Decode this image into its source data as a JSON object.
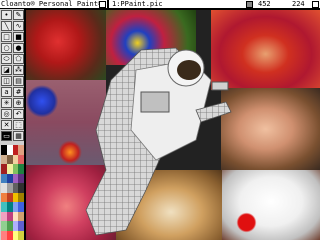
{
  "menubar": {
    "app_title": "Cloanto® Personal Paint®",
    "file_name": "1:PPaint.pic",
    "coord_x": "452",
    "coord_y": "224"
  },
  "tools": [
    {
      "name": "dot-brush-tool",
      "glyph": "•"
    },
    {
      "name": "freehand-tool",
      "glyph": "✎"
    },
    {
      "name": "line-tool",
      "glyph": "╲"
    },
    {
      "name": "curve-tool",
      "glyph": "∿"
    },
    {
      "name": "rectangle-tool",
      "glyph": "□"
    },
    {
      "name": "filled-rectangle-tool",
      "glyph": "■"
    },
    {
      "name": "circle-tool",
      "glyph": "○"
    },
    {
      "name": "filled-circle-tool",
      "glyph": "●"
    },
    {
      "name": "ellipse-tool",
      "glyph": "⬭"
    },
    {
      "name": "polygon-tool",
      "glyph": "⬠"
    },
    {
      "name": "fill-tool",
      "glyph": "◪"
    },
    {
      "name": "airbrush-tool",
      "glyph": "⁂"
    },
    {
      "name": "brush-select-tool",
      "glyph": "◫"
    },
    {
      "name": "gradient-tool",
      "glyph": "▤"
    },
    {
      "name": "text-tool",
      "glyph": "a"
    },
    {
      "name": "grid-tool",
      "glyph": "#"
    },
    {
      "name": "symmetry-tool",
      "glyph": "✳"
    },
    {
      "name": "magnify-tool",
      "glyph": "⊕"
    },
    {
      "name": "zoom-tool",
      "glyph": "◎"
    },
    {
      "name": "undo-tool",
      "glyph": "↶"
    },
    {
      "name": "clear-tool",
      "glyph": "✕"
    },
    {
      "name": "pick-color-tool",
      "glyph": "⬚"
    },
    {
      "name": "screen-tool",
      "glyph": "▭"
    },
    {
      "name": "stencil-tool",
      "glyph": "▦"
    }
  ],
  "colors": {
    "menubar_bg": "#ffffff",
    "toolbox_bg": "#cfcfcf",
    "palette": [
      "#000000",
      "#ffffff",
      "#c02020",
      "#e0a080",
      "#d0b090",
      "#806040",
      "#f0d0a0",
      "#e06060",
      "#a02020",
      "#f0f0a0",
      "#80c060",
      "#208040",
      "#4080c0",
      "#2040a0",
      "#a060c0",
      "#603080",
      "#e0e0e0",
      "#a0a0a0",
      "#606060",
      "#303030",
      "#f08040",
      "#c04020",
      "#f0c000",
      "#a08000",
      "#40c0c0",
      "#008080",
      "#80a0f0",
      "#4060e0",
      "#f0a0c0",
      "#c04080",
      "#ffe0c0",
      "#d0a070",
      "#90d090",
      "#50a050",
      "#b0b0ff",
      "#6060d0",
      "#ff8080",
      "#ff4040",
      "#ffff80",
      "#d0d040"
    ]
  }
}
